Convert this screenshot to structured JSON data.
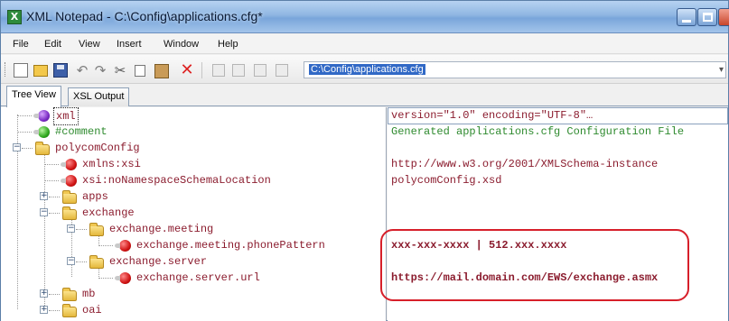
{
  "window": {
    "title": "XML Notepad - C:\\Config\\applications.cfg*",
    "app_icon": "X"
  },
  "menu": {
    "items": [
      "File",
      "Edit",
      "View",
      "Insert",
      "Window",
      "Help"
    ]
  },
  "toolbar": {
    "buttons": [
      "new-icon",
      "open-icon",
      "save-icon",
      "undo-icon",
      "redo-icon",
      "cut-icon",
      "copy-icon",
      "paste-icon",
      "delete-icon",
      "nudge-up-icon",
      "nudge-down-icon",
      "indent-icon",
      "outdent-icon"
    ],
    "path_value": "C:\\Config\\applications.cfg"
  },
  "tabs": [
    {
      "label": "Tree View",
      "active": true
    },
    {
      "label": "XSL Output",
      "active": false
    }
  ],
  "tree": [
    {
      "label": "xml",
      "icon": "purple-dot-icon"
    },
    {
      "label": "#comment",
      "icon": "green-dot-icon"
    },
    {
      "label": "polycomConfig",
      "icon": "folder-icon",
      "expander": "−"
    },
    {
      "label": "xmlns:xsi",
      "icon": "red-dot-icon"
    },
    {
      "label": "xsi:noNamespaceSchemaLocation",
      "icon": "red-dot-icon"
    },
    {
      "label": "apps",
      "icon": "folder-icon",
      "expander": "+"
    },
    {
      "label": "exchange",
      "icon": "folder-icon",
      "expander": "−"
    },
    {
      "label": "exchange.meeting",
      "icon": "folder-icon",
      "expander": "−"
    },
    {
      "label": "exchange.meeting.phonePattern",
      "icon": "red-dot-icon"
    },
    {
      "label": "exchange.server",
      "icon": "folder-icon",
      "expander": "−"
    },
    {
      "label": "exchange.server.url",
      "icon": "red-dot-icon"
    },
    {
      "label": "mb",
      "icon": "folder-icon",
      "expander": "+"
    },
    {
      "label": "oai",
      "icon": "folder-icon",
      "expander": "+"
    }
  ],
  "values": [
    "version=\"1.0\" encoding=\"UTF-8\"…",
    "Generated applications.cfg Configuration File",
    "",
    "http://www.w3.org/2001/XMLSchema-instance",
    "polycomConfig.xsd",
    "",
    "",
    "",
    "xxx-xxx-xxxx | 512.xxx.xxxx",
    "",
    "https://mail.domain.com/EWS/exchange.asmx",
    "",
    ""
  ],
  "colors": {
    "accent": "#3169c6",
    "highlight": "#d71f2a",
    "node_text": "#8b1c2e",
    "comment_text": "#2e8a2e"
  }
}
